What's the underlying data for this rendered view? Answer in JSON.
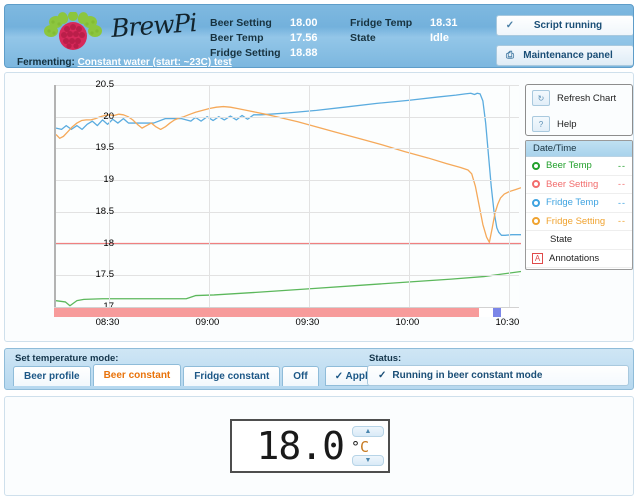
{
  "header": {
    "brand": "BrewPi",
    "logo_icon": "raspberry-pi-logo",
    "stats_left": [
      {
        "label": "Beer Setting",
        "value": "18.00"
      },
      {
        "label": "Beer Temp",
        "value": "17.56"
      },
      {
        "label": "Fridge Setting",
        "value": "18.88"
      }
    ],
    "stats_right": [
      {
        "label": "Fridge Temp",
        "value": "18.31"
      },
      {
        "label": "State",
        "value": "Idle"
      }
    ],
    "fermenting_label": "Fermenting:",
    "fermenting_link": "Constant water (start: ~23C) test",
    "script_button": {
      "label": "Script running",
      "icon": "check-icon"
    },
    "maintenance_button": {
      "label": "Maintenance panel",
      "icon": "window-icon"
    }
  },
  "chart_buttons": [
    {
      "label": "Refresh Chart",
      "icon": "refresh-icon"
    },
    {
      "label": "Help",
      "icon": "question-icon"
    }
  ],
  "legend": {
    "header": "Date/Time",
    "rows": [
      {
        "label": "Beer Temp",
        "color": "#22a02c",
        "dash": "--"
      },
      {
        "label": "Beer Setting",
        "color": "#f26d6d",
        "dash": "--"
      },
      {
        "label": "Fridge Temp",
        "color": "#3fa3e0",
        "dash": "--"
      },
      {
        "label": "Fridge Setting",
        "color": "#f0a330",
        "dash": "--"
      },
      {
        "label": "State",
        "color": "#333333",
        "dash": ""
      },
      {
        "label": "Annotations",
        "color": "#e04a4a",
        "dash": "",
        "icon": "annotation-a-icon"
      }
    ]
  },
  "chart_data": {
    "type": "line",
    "title": "",
    "xlabel": "",
    "ylabel": "",
    "ylim": [
      17,
      20.5
    ],
    "yticks": [
      "17",
      "17.5",
      "18",
      "18.5",
      "19",
      "19.5",
      "20",
      "20.5"
    ],
    "xticks": [
      "08:30",
      "09:00",
      "09:30",
      "10:00",
      "10:30"
    ],
    "grid": true,
    "legend_position": "right",
    "series": [
      {
        "name": "Beer Temp",
        "color": "#5cb85c",
        "points": [
          [
            0.0,
            17.1
          ],
          [
            0.02,
            17.08
          ],
          [
            0.03,
            17.02
          ],
          [
            0.045,
            17.1
          ],
          [
            0.06,
            17.12
          ],
          [
            0.1,
            17.13
          ],
          [
            0.2,
            17.13
          ],
          [
            0.28,
            17.13
          ],
          [
            0.3,
            17.18
          ],
          [
            0.34,
            17.19
          ],
          [
            0.45,
            17.24
          ],
          [
            0.55,
            17.29
          ],
          [
            0.65,
            17.34
          ],
          [
            0.75,
            17.39
          ],
          [
            0.85,
            17.44
          ],
          [
            0.92,
            17.48
          ],
          [
            0.96,
            17.52
          ],
          [
            1.0,
            17.56
          ]
        ]
      },
      {
        "name": "Beer Setting",
        "color": "#f08080",
        "points": [
          [
            0.0,
            18.0
          ],
          [
            1.0,
            18.0
          ]
        ]
      },
      {
        "name": "Fridge Temp",
        "color": "#5bacdf",
        "points": [
          [
            0.0,
            19.82
          ],
          [
            0.012,
            19.8
          ],
          [
            0.022,
            19.86
          ],
          [
            0.033,
            19.8
          ],
          [
            0.045,
            19.86
          ],
          [
            0.056,
            19.8
          ],
          [
            0.067,
            19.88
          ],
          [
            0.078,
            19.93
          ],
          [
            0.089,
            19.86
          ],
          [
            0.1,
            19.95
          ],
          [
            0.111,
            19.88
          ],
          [
            0.122,
            19.96
          ],
          [
            0.133,
            19.9
          ],
          [
            0.145,
            19.97
          ],
          [
            0.156,
            19.9
          ],
          [
            0.168,
            19.9
          ],
          [
            0.19,
            19.9
          ],
          [
            0.21,
            19.9
          ],
          [
            0.235,
            19.97
          ],
          [
            0.25,
            19.97
          ],
          [
            0.27,
            19.97
          ],
          [
            0.29,
            19.93
          ],
          [
            0.3,
            19.99
          ],
          [
            0.312,
            19.93
          ],
          [
            0.325,
            20.0
          ],
          [
            0.338,
            19.94
          ],
          [
            0.35,
            20.0
          ],
          [
            0.362,
            19.95
          ],
          [
            0.375,
            20.01
          ],
          [
            0.388,
            19.95
          ],
          [
            0.4,
            20.02
          ],
          [
            0.412,
            19.96
          ],
          [
            0.425,
            20.03
          ],
          [
            0.44,
            20.03
          ],
          [
            0.46,
            20.04
          ],
          [
            0.5,
            20.06
          ],
          [
            0.56,
            20.1
          ],
          [
            0.62,
            20.15
          ],
          [
            0.69,
            20.21
          ],
          [
            0.76,
            20.26
          ],
          [
            0.82,
            20.31
          ],
          [
            0.86,
            20.34
          ],
          [
            0.88,
            20.36
          ],
          [
            0.892,
            20.37
          ],
          [
            0.9,
            20.35
          ],
          [
            0.906,
            20.37
          ],
          [
            0.912,
            20.36
          ],
          [
            0.918,
            20.25
          ],
          [
            0.924,
            19.9
          ],
          [
            0.93,
            19.4
          ],
          [
            0.936,
            18.9
          ],
          [
            0.942,
            18.5
          ],
          [
            0.948,
            18.25
          ],
          [
            0.952,
            18.18
          ],
          [
            0.958,
            18.13
          ],
          [
            0.966,
            18.13
          ],
          [
            0.98,
            18.14
          ],
          [
            1.0,
            18.14
          ]
        ]
      },
      {
        "name": "Fridge Setting",
        "color": "#f5a95a",
        "points": [
          [
            0.0,
            19.72
          ],
          [
            0.008,
            19.66
          ],
          [
            0.016,
            19.69
          ],
          [
            0.025,
            19.76
          ],
          [
            0.035,
            19.84
          ],
          [
            0.045,
            19.9
          ],
          [
            0.055,
            19.94
          ],
          [
            0.065,
            19.95
          ],
          [
            0.075,
            19.95
          ],
          [
            0.085,
            19.97
          ],
          [
            0.095,
            20.0
          ],
          [
            0.105,
            20.02
          ],
          [
            0.115,
            20.03
          ],
          [
            0.125,
            20.02
          ],
          [
            0.135,
            20.04
          ],
          [
            0.145,
            20.03
          ],
          [
            0.155,
            20.0
          ],
          [
            0.165,
            19.95
          ],
          [
            0.175,
            19.88
          ],
          [
            0.185,
            19.82
          ],
          [
            0.195,
            19.86
          ],
          [
            0.205,
            19.9
          ],
          [
            0.215,
            19.84
          ],
          [
            0.225,
            19.8
          ],
          [
            0.235,
            19.84
          ],
          [
            0.245,
            19.9
          ],
          [
            0.255,
            19.95
          ],
          [
            0.265,
            19.98
          ],
          [
            0.275,
            20.0
          ],
          [
            0.285,
            20.03
          ],
          [
            0.3,
            20.07
          ],
          [
            0.315,
            20.1
          ],
          [
            0.33,
            20.13
          ],
          [
            0.345,
            20.15
          ],
          [
            0.36,
            20.16
          ],
          [
            0.375,
            20.15
          ],
          [
            0.39,
            20.13
          ],
          [
            0.41,
            20.1
          ],
          [
            0.43,
            20.07
          ],
          [
            0.45,
            20.04
          ],
          [
            0.48,
            19.99
          ],
          [
            0.52,
            19.92
          ],
          [
            0.56,
            19.84
          ],
          [
            0.6,
            19.76
          ],
          [
            0.65,
            19.66
          ],
          [
            0.7,
            19.56
          ],
          [
            0.75,
            19.45
          ],
          [
            0.8,
            19.35
          ],
          [
            0.84,
            19.26
          ],
          [
            0.87,
            19.2
          ],
          [
            0.886,
            19.16
          ],
          [
            0.894,
            19.1
          ],
          [
            0.902,
            18.9
          ],
          [
            0.91,
            18.6
          ],
          [
            0.918,
            18.3
          ],
          [
            0.926,
            18.1
          ],
          [
            0.932,
            18.02
          ],
          [
            0.938,
            18.24
          ],
          [
            0.944,
            18.48
          ],
          [
            0.95,
            18.62
          ],
          [
            0.956,
            18.72
          ],
          [
            0.964,
            18.78
          ],
          [
            0.975,
            18.82
          ],
          [
            0.988,
            18.85
          ],
          [
            1.0,
            18.88
          ]
        ]
      }
    ],
    "state_band": {
      "label": "State",
      "segments": [
        {
          "start": 0.0,
          "end": 0.915,
          "color": "#f79b9b"
        },
        {
          "start": 0.915,
          "end": 0.945,
          "color": "#ffffff"
        },
        {
          "start": 0.945,
          "end": 0.962,
          "color": "#7b86e8"
        },
        {
          "start": 0.962,
          "end": 1.0,
          "color": "#ffffff"
        }
      ]
    }
  },
  "mode_panel": {
    "title": "Set temperature mode:",
    "status_title": "Status:",
    "tabs": [
      {
        "label": "Beer profile",
        "active": false
      },
      {
        "label": "Beer constant",
        "active": true
      },
      {
        "label": "Fridge constant",
        "active": false
      },
      {
        "label": "Off",
        "active": false
      }
    ],
    "apply": {
      "label": "Apply",
      "icon": "check-icon"
    },
    "status": {
      "label": "Running in beer constant mode",
      "icon": "check-icon"
    }
  },
  "stepper": {
    "value": "18.0",
    "unit_degree": "°",
    "unit_letter": "C",
    "up_icon": "triangle-up-icon",
    "down_icon": "triangle-down-icon"
  }
}
